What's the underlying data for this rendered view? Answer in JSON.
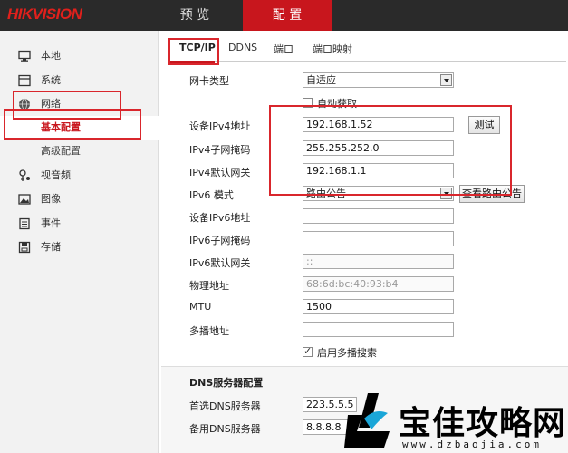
{
  "app": {
    "logo": "HIKVISION"
  },
  "topnav": {
    "preview": "预 览",
    "config": "配 置"
  },
  "sidebar": {
    "items": [
      {
        "label": "本地",
        "icon": "monitor-icon"
      },
      {
        "label": "系统",
        "icon": "system-icon"
      },
      {
        "label": "网络",
        "icon": "globe-icon"
      },
      {
        "label": "视音频",
        "icon": "audio-video-icon"
      },
      {
        "label": "图像",
        "icon": "image-icon"
      },
      {
        "label": "事件",
        "icon": "event-icon"
      },
      {
        "label": "存储",
        "icon": "storage-icon"
      }
    ],
    "sub_items": [
      {
        "label": "基本配置"
      },
      {
        "label": "高级配置"
      }
    ]
  },
  "tabs": [
    {
      "label": "TCP/IP"
    },
    {
      "label": "DDNS"
    },
    {
      "label": "端口"
    },
    {
      "label": "端口映射"
    }
  ],
  "form": {
    "nic_type": {
      "label": "网卡类型",
      "value": "自适应"
    },
    "dhcp": {
      "label": "自动获取",
      "checked": false
    },
    "ipv4_addr": {
      "label": "设备IPv4地址",
      "value": "192.168.1.52"
    },
    "test_button": "测试",
    "ipv4_mask": {
      "label": "IPv4子网掩码",
      "value": "255.255.252.0"
    },
    "ipv4_gw": {
      "label": "IPv4默认网关",
      "value": "192.168.1.1"
    },
    "ipv6_mode": {
      "label": "IPv6 模式",
      "value": "路由公告"
    },
    "view_route_button": "查看路由公告",
    "ipv6_addr": {
      "label": "设备IPv6地址",
      "value": ""
    },
    "ipv6_mask": {
      "label": "IPv6子网掩码",
      "value": ""
    },
    "ipv6_gw": {
      "label": "IPv6默认网关",
      "value": "::"
    },
    "mac": {
      "label": "物理地址",
      "value": "68:6d:bc:40:93:b4"
    },
    "mtu": {
      "label": "MTU",
      "value": "1500"
    },
    "multicast": {
      "label": "多播地址",
      "value": ""
    },
    "multicast_search": {
      "label": "启用多播搜索",
      "checked": true
    }
  },
  "dns": {
    "section_title": "DNS服务器配置",
    "preferred": {
      "label": "首选DNS服务器",
      "value": "223.5.5.5"
    },
    "alternate": {
      "label": "备用DNS服务器",
      "value": "8.8.8.8"
    }
  },
  "watermark": {
    "text": "宝佳攻略网",
    "url": "www.dzbaojia.com"
  },
  "colors": {
    "accent": "#c8161d",
    "annotation": "#d9262c",
    "topbar": "#2a2a2a"
  }
}
